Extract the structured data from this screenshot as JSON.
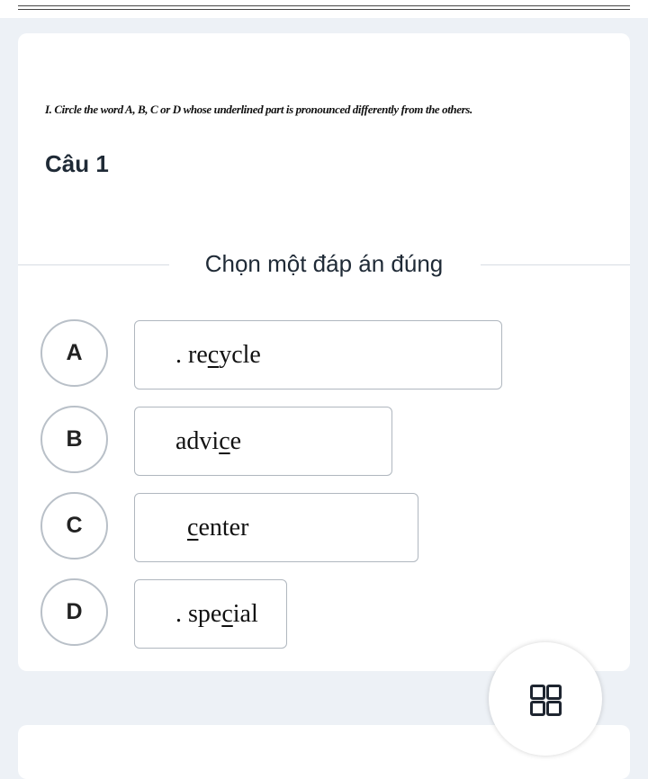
{
  "instruction": "I. Circle the word A, B, C or D whose underlined part is pronounced differently from the others.",
  "question": {
    "title": "Câu 1",
    "prompt": "Chọn một đáp án đúng"
  },
  "options": [
    {
      "letter": "A",
      "pre": ". re",
      "underlined": "c",
      "post": "ycle"
    },
    {
      "letter": "B",
      "pre": "advi",
      "underlined": "c",
      "post": "e"
    },
    {
      "letter": "C",
      "pre": "",
      "underlined": "c",
      "post": "enter"
    },
    {
      "letter": "D",
      "pre": ". spe",
      "underlined": "c",
      "post": "ial"
    }
  ],
  "fab": {
    "icon": "grid-icon"
  }
}
